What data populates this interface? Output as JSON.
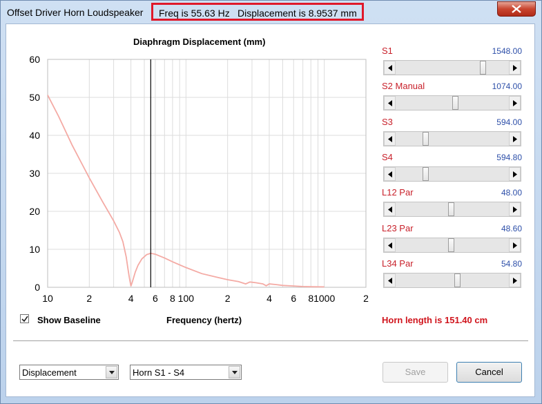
{
  "window": {
    "title": "Offset Driver Horn Loudspeaker",
    "freq_readout": "Freq is 55.63 Hz",
    "disp_readout": "Displacement is 8.9537 mm",
    "close_icon": "close-icon"
  },
  "chart": {
    "show_baseline_label": "Show Baseline",
    "show_baseline_checked": true,
    "xlabel": "Frequency (hertz)"
  },
  "chart_data": {
    "type": "line",
    "title": "Diaphragm Displacement (mm)",
    "xlabel": "Frequency (hertz)",
    "ylabel": "",
    "x_scale": "log",
    "xlim": [
      10,
      2000
    ],
    "ylim": [
      0,
      60
    ],
    "grid": true,
    "y_ticks": [
      "0",
      "10",
      "20",
      "30",
      "40",
      "50",
      "60"
    ],
    "x_ticks": [
      {
        "x": 10,
        "label": "10"
      },
      {
        "x": 20,
        "label": "2"
      },
      {
        "x": 40,
        "label": "4"
      },
      {
        "x": 60,
        "label": "6"
      },
      {
        "x": 80,
        "label": "8"
      },
      {
        "x": 100,
        "label": "100"
      },
      {
        "x": 200,
        "label": "2"
      },
      {
        "x": 400,
        "label": "4"
      },
      {
        "x": 600,
        "label": "6"
      },
      {
        "x": 800,
        "label": "8"
      },
      {
        "x": 1000,
        "label": "1000"
      },
      {
        "x": 2000,
        "label": "2"
      }
    ],
    "cursor_x": 55.63,
    "line_color": "#f4aaa4",
    "series": [
      {
        "values": [
          [
            10,
            50.6
          ],
          [
            12,
            45
          ],
          [
            15,
            37.5
          ],
          [
            18,
            32
          ],
          [
            20,
            28.8
          ],
          [
            25,
            22.5
          ],
          [
            30,
            17.5
          ],
          [
            33,
            14.5
          ],
          [
            35,
            12
          ],
          [
            37,
            8
          ],
          [
            38,
            5
          ],
          [
            39,
            2.5
          ],
          [
            40,
            0.3
          ],
          [
            41,
            1.5
          ],
          [
            43,
            4
          ],
          [
            45,
            5.8
          ],
          [
            48,
            7.5
          ],
          [
            52,
            8.6
          ],
          [
            55.6,
            8.95
          ],
          [
            60,
            8.7
          ],
          [
            70,
            7.7
          ],
          [
            80,
            6.7
          ],
          [
            100,
            5.2
          ],
          [
            130,
            3.6
          ],
          [
            170,
            2.6
          ],
          [
            200,
            2
          ],
          [
            240,
            1.5
          ],
          [
            270,
            0.9
          ],
          [
            290,
            1.4
          ],
          [
            320,
            1.2
          ],
          [
            360,
            0.9
          ],
          [
            380,
            0.4
          ],
          [
            400,
            0.9
          ],
          [
            450,
            0.7
          ],
          [
            500,
            0.5
          ],
          [
            600,
            0.35
          ],
          [
            700,
            0.2
          ],
          [
            800,
            0.15
          ],
          [
            1000,
            0.1
          ]
        ]
      }
    ]
  },
  "sliders": [
    {
      "label": "S1",
      "value": "1548.00",
      "pos": 0.79
    },
    {
      "label": "S2 Manual",
      "value": "1074.00",
      "pos": 0.53
    },
    {
      "label": "S3",
      "value": "594.00",
      "pos": 0.25
    },
    {
      "label": "S4",
      "value": "594.80",
      "pos": 0.25
    },
    {
      "label": "L12 Par",
      "value": "48.00",
      "pos": 0.49
    },
    {
      "label": "L23 Par",
      "value": "48.60",
      "pos": 0.49
    },
    {
      "label": "L34 Par",
      "value": "54.80",
      "pos": 0.55
    }
  ],
  "horn_length": "Horn length is 151.40 cm",
  "controls": {
    "plot_type": "Displacement",
    "horn_section": "Horn S1 - S4",
    "save_label": "Save",
    "cancel_label": "Cancel"
  }
}
